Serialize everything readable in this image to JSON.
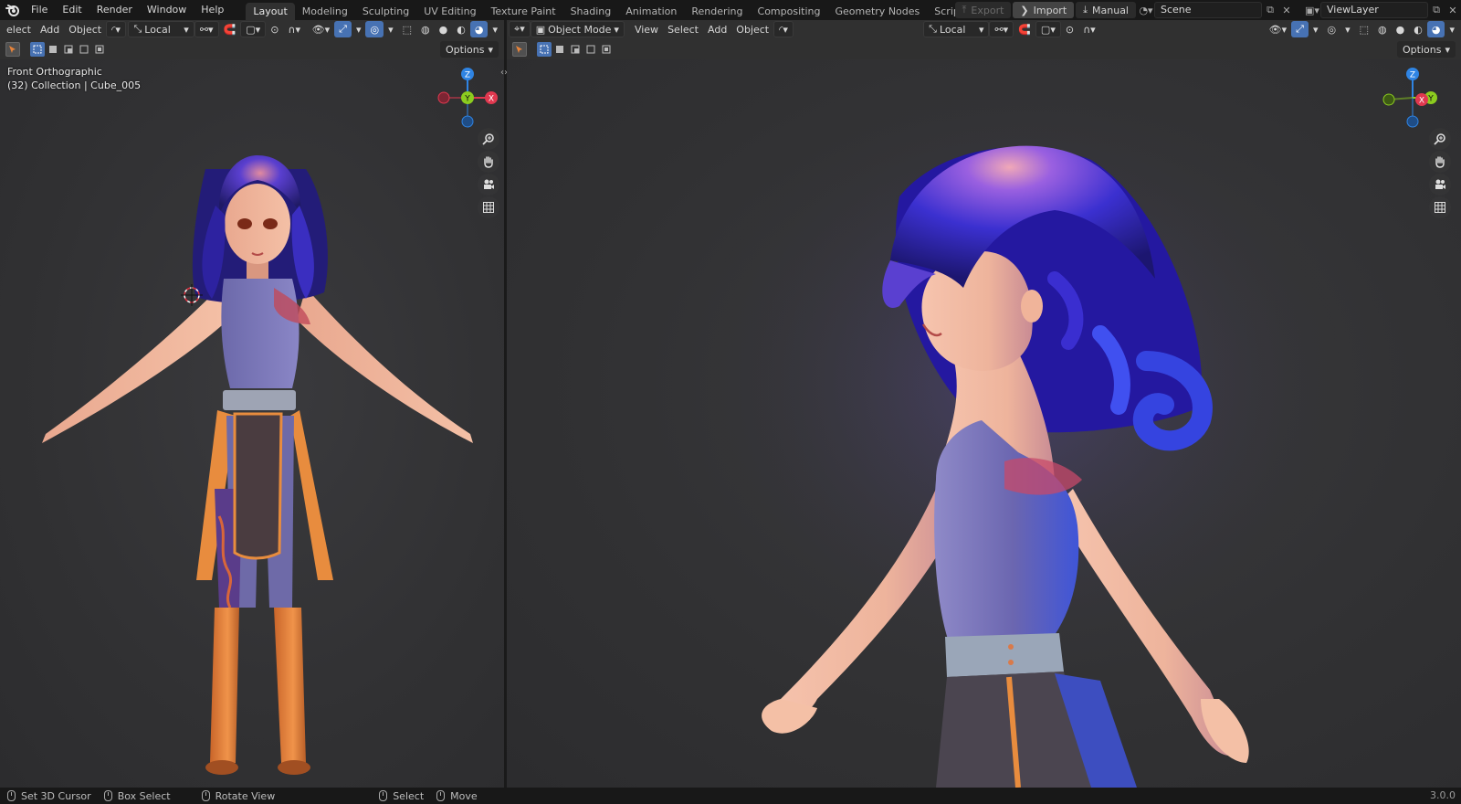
{
  "menu": {
    "items": [
      "File",
      "Edit",
      "Render",
      "Window",
      "Help"
    ]
  },
  "workspaces": {
    "tabs": [
      "Layout",
      "Modeling",
      "Sculpting",
      "UV Editing",
      "Texture Paint",
      "Shading",
      "Animation",
      "Rendering",
      "Compositing",
      "Geometry Nodes",
      "Scripting"
    ],
    "active": "Layout",
    "add": "+"
  },
  "topright": {
    "export_label": "Export",
    "import_label": "Import",
    "manual_label": "Manual",
    "scene_name": "Scene",
    "view_layer": "ViewLayer"
  },
  "left_editor": {
    "header": {
      "select": "elect",
      "add": "Add",
      "object": "Object",
      "orientation": "Local"
    },
    "options": "Options",
    "info_line1": "Front Orthographic",
    "info_line2": "(32) Collection | Cube_005"
  },
  "right_editor": {
    "header": {
      "mode": "Object Mode",
      "view": "View",
      "select": "Select",
      "add": "Add",
      "object": "Object",
      "orientation": "Local"
    },
    "options": "Options"
  },
  "gizmo": {
    "z": "Z",
    "y": "Y",
    "x": "X"
  },
  "status": {
    "set_cursor": "Set 3D Cursor",
    "box_select": "Box Select",
    "rotate_view": "Rotate View",
    "select": "Select",
    "move": "Move",
    "version": "3.0.0"
  },
  "colors": {
    "accent": "#4772b3",
    "axis_x": "#e0384f",
    "axis_y": "#8ccc1f",
    "axis_z": "#2f84e3",
    "hair": "#3b2fb8",
    "skin": "#f2b49a",
    "outfit": "#7a76b8",
    "boots": "#e8843a"
  }
}
